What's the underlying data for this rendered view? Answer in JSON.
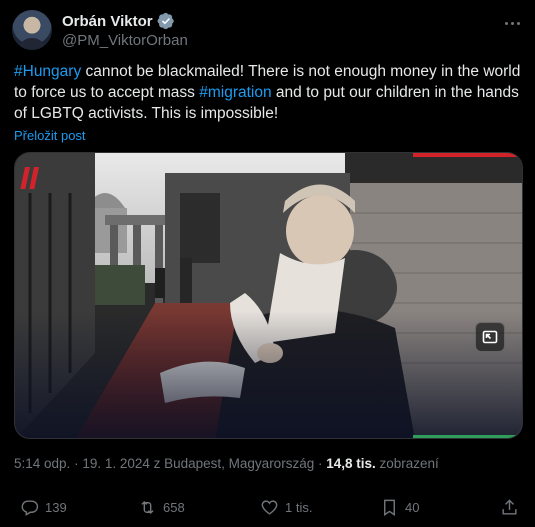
{
  "author": {
    "name": "Orbán Viktor",
    "handle": "@PM_ViktorOrban"
  },
  "tweet": {
    "segments": [
      {
        "type": "hashtag",
        "text": "#Hungary"
      },
      {
        "type": "text",
        "text": " cannot be blackmailed! There is not enough money in the world to force us to accept mass "
      },
      {
        "type": "hashtag",
        "text": "#migration"
      },
      {
        "type": "text",
        "text": " and to put our children in the hands of LGBTQ activists. This is impossible!"
      }
    ],
    "translate_label": "Přeložit post"
  },
  "meta": {
    "time": "5:14 odp.",
    "sep1": " · ",
    "date": "19. 1. 2024 z Budapest, Magyarország",
    "sep2": " · ",
    "views": "14,8 tis.",
    "views_label": " zobrazení"
  },
  "actions": {
    "replies": "139",
    "reposts": "658",
    "likes": "1 tis.",
    "bookmarks": "40"
  },
  "colors": {
    "accent": "#1d9bf0",
    "secondary_text": "#71767b",
    "flag_red": "#d2232a",
    "flag_green": "#2e9e5a"
  },
  "icons": [
    "verified-badge-icon",
    "more-icon",
    "expand-icon",
    "reply-icon",
    "repost-icon",
    "like-icon",
    "bookmark-icon",
    "share-icon"
  ]
}
